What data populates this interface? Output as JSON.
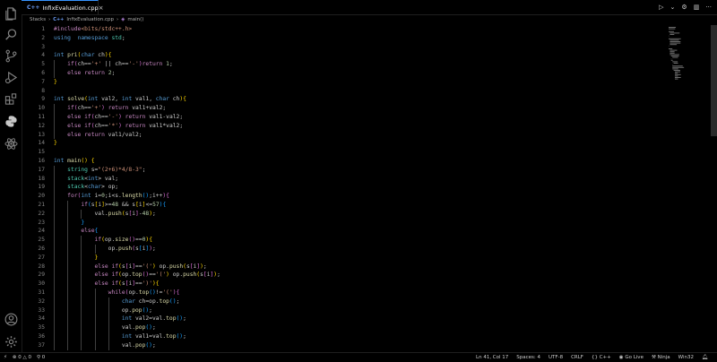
{
  "tab": {
    "icon_text": "C++",
    "filename": "InfixEvaluation.cpp",
    "close": "×"
  },
  "tab_actions": {
    "run": "▷",
    "run_dropdown": "⌄",
    "settings": "⚙",
    "split": "▥",
    "more": "···"
  },
  "breadcrumb": {
    "folder": "Stacks",
    "sep1": "›",
    "file": "InfixEvaluation.cpp",
    "sep2": "›",
    "func_icon": "◈",
    "func": "main()"
  },
  "status": {
    "remote": "⚡",
    "errors": "0",
    "warnings": "0",
    "ports": "0",
    "position": "Ln 41, Col 17",
    "spaces": "Spaces: 4",
    "encoding": "UTF-8",
    "eol": "CRLF",
    "language": "C++",
    "golive": "Go Live",
    "ninja": "Ninja",
    "platform": "Win32"
  },
  "colors": {
    "accent": "#3794ff",
    "background": "#000000",
    "keyword": "#569cd6",
    "string": "#ce9178",
    "function": "#dcdcaa",
    "type": "#4ec9b0",
    "preprocessor": "#c586c0"
  },
  "code_lines": [
    {
      "n": "1",
      "t": [
        [
          "pp",
          "#include"
        ],
        [
          "inc",
          "<bits/stdc++.h>"
        ]
      ]
    },
    {
      "n": "2",
      "t": [
        [
          "kw",
          "using"
        ],
        [
          "",
          "  "
        ],
        [
          "kw",
          "namespace"
        ],
        [
          "",
          ""
        ],
        [
          "ty",
          " std"
        ],
        [
          "",
          ";"
        ]
      ]
    },
    {
      "n": "3",
      "t": []
    },
    {
      "n": "4",
      "t": [
        [
          "kw",
          "int"
        ],
        [
          "",
          " "
        ],
        [
          "fn",
          "pri"
        ],
        [
          "br1",
          "("
        ],
        [
          "kw",
          "char"
        ],
        [
          "",
          " ch"
        ],
        [
          "br1",
          ")"
        ],
        [
          "br1",
          "{"
        ]
      ]
    },
    {
      "n": "5",
      "t": [
        [
          "",
          "    "
        ],
        [
          "ctl",
          "if"
        ],
        [
          "br2",
          "("
        ],
        [
          "",
          "ch=="
        ],
        [
          "str",
          "'+'"
        ],
        [
          "",
          " || ch=="
        ],
        [
          "str",
          "'-'"
        ],
        [
          "br2",
          ")"
        ],
        [
          "ctl",
          "return"
        ],
        [
          "",
          " "
        ],
        [
          "num",
          "1"
        ],
        [
          "",
          ";"
        ]
      ]
    },
    {
      "n": "6",
      "t": [
        [
          "",
          "    "
        ],
        [
          "ctl",
          "else"
        ],
        [
          "",
          " "
        ],
        [
          "ctl",
          "return"
        ],
        [
          "",
          " "
        ],
        [
          "num",
          "2"
        ],
        [
          "",
          ";"
        ]
      ]
    },
    {
      "n": "7",
      "t": [
        [
          "br1",
          "}"
        ]
      ]
    },
    {
      "n": "8",
      "t": []
    },
    {
      "n": "9",
      "t": [
        [
          "kw",
          "int"
        ],
        [
          "",
          " "
        ],
        [
          "fn",
          "solve"
        ],
        [
          "br1",
          "("
        ],
        [
          "kw",
          "int"
        ],
        [
          "",
          " val2, "
        ],
        [
          "kw",
          "int"
        ],
        [
          "",
          " val1, "
        ],
        [
          "kw",
          "char"
        ],
        [
          "",
          " ch"
        ],
        [
          "br1",
          ")"
        ],
        [
          "br1",
          "{"
        ]
      ]
    },
    {
      "n": "10",
      "t": [
        [
          "",
          "    "
        ],
        [
          "ctl",
          "if"
        ],
        [
          "br2",
          "("
        ],
        [
          "",
          "ch=="
        ],
        [
          "str",
          "'+'"
        ],
        [
          "br2",
          ")"
        ],
        [
          "",
          " "
        ],
        [
          "ctl",
          "return"
        ],
        [
          "",
          " val1+val2;"
        ]
      ]
    },
    {
      "n": "11",
      "t": [
        [
          "",
          "    "
        ],
        [
          "ctl",
          "else if"
        ],
        [
          "br2",
          "("
        ],
        [
          "",
          "ch=="
        ],
        [
          "str",
          "'-'"
        ],
        [
          "br2",
          ")"
        ],
        [
          "",
          " "
        ],
        [
          "ctl",
          "return"
        ],
        [
          "",
          " val1-val2;"
        ]
      ]
    },
    {
      "n": "12",
      "t": [
        [
          "",
          "    "
        ],
        [
          "ctl",
          "else if"
        ],
        [
          "br2",
          "("
        ],
        [
          "",
          "ch=="
        ],
        [
          "str",
          "'*'"
        ],
        [
          "br2",
          ")"
        ],
        [
          "",
          " "
        ],
        [
          "ctl",
          "return"
        ],
        [
          "",
          " val1*val2;"
        ]
      ]
    },
    {
      "n": "13",
      "t": [
        [
          "",
          "    "
        ],
        [
          "ctl",
          "else"
        ],
        [
          "",
          " "
        ],
        [
          "ctl",
          "return"
        ],
        [
          "",
          " val1/val2;"
        ]
      ]
    },
    {
      "n": "14",
      "t": [
        [
          "br1",
          "}"
        ]
      ]
    },
    {
      "n": "15",
      "t": []
    },
    {
      "n": "16",
      "t": [
        [
          "kw",
          "int"
        ],
        [
          "",
          " "
        ],
        [
          "fn",
          "main"
        ],
        [
          "br1",
          "()"
        ],
        [
          "",
          " "
        ],
        [
          "br1",
          "{"
        ]
      ]
    },
    {
      "n": "17",
      "t": [
        [
          "",
          "    "
        ],
        [
          "ty",
          "string"
        ],
        [
          "",
          " s="
        ],
        [
          "str",
          "\"(2+6)*4/8-3\""
        ],
        [
          "",
          ";"
        ]
      ]
    },
    {
      "n": "18",
      "t": [
        [
          "",
          "    "
        ],
        [
          "ty",
          "stack"
        ],
        [
          "",
          "<"
        ],
        [
          "kw",
          "int"
        ],
        [
          "",
          "> val;"
        ]
      ]
    },
    {
      "n": "19",
      "t": [
        [
          "",
          "    "
        ],
        [
          "ty",
          "stack"
        ],
        [
          "",
          "<"
        ],
        [
          "kw",
          "char"
        ],
        [
          "",
          "> op;"
        ]
      ]
    },
    {
      "n": "20",
      "t": [
        [
          "",
          "    "
        ],
        [
          "ctl",
          "for"
        ],
        [
          "br2",
          "("
        ],
        [
          "kw",
          "int"
        ],
        [
          "",
          " i="
        ],
        [
          "num",
          "0"
        ],
        [
          "",
          ";i<s."
        ],
        [
          "fn",
          "length"
        ],
        [
          "br3",
          "()"
        ],
        [
          "",
          ";i++"
        ],
        [
          "br2",
          ")"
        ],
        [
          "br2",
          "{"
        ]
      ]
    },
    {
      "n": "21",
      "t": [
        [
          "",
          "        "
        ],
        [
          "ctl",
          "if"
        ],
        [
          "br3",
          "("
        ],
        [
          "",
          "s"
        ],
        [
          "br1",
          "["
        ],
        [
          "",
          "i"
        ],
        [
          "br1",
          "]"
        ],
        [
          "",
          ">="
        ],
        [
          "num",
          "48"
        ],
        [
          "",
          " && s"
        ],
        [
          "br1",
          "["
        ],
        [
          "",
          "i"
        ],
        [
          "br1",
          "]"
        ],
        [
          "",
          "<="
        ],
        [
          "num",
          "57"
        ],
        [
          "br3",
          ")"
        ],
        [
          "br3",
          "{"
        ]
      ]
    },
    {
      "n": "22",
      "t": [
        [
          "",
          "            val."
        ],
        [
          "fn",
          "push"
        ],
        [
          "br1",
          "("
        ],
        [
          "",
          "s"
        ],
        [
          "br2",
          "["
        ],
        [
          "",
          "i"
        ],
        [
          "br2",
          "]"
        ],
        [
          "",
          "-"
        ],
        [
          "num",
          "48"
        ],
        [
          "br1",
          ")"
        ],
        [
          "",
          ";"
        ]
      ]
    },
    {
      "n": "23",
      "t": [
        [
          "",
          "        "
        ],
        [
          "br3",
          "}"
        ]
      ]
    },
    {
      "n": "24",
      "t": [
        [
          "",
          "        "
        ],
        [
          "ctl",
          "else"
        ],
        [
          "br3",
          "{"
        ]
      ]
    },
    {
      "n": "25",
      "t": [
        [
          "",
          "            "
        ],
        [
          "ctl",
          "if"
        ],
        [
          "br1",
          "("
        ],
        [
          "",
          "op."
        ],
        [
          "fn",
          "size"
        ],
        [
          "br2",
          "()"
        ],
        [
          "",
          "=="
        ],
        [
          "num",
          "0"
        ],
        [
          "br1",
          ")"
        ],
        [
          "br1",
          "{"
        ]
      ]
    },
    {
      "n": "26",
      "t": [
        [
          "",
          "                op."
        ],
        [
          "fn",
          "push"
        ],
        [
          "br2",
          "("
        ],
        [
          "",
          "s"
        ],
        [
          "br3",
          "["
        ],
        [
          "",
          "i"
        ],
        [
          "br3",
          "]"
        ],
        [
          "br2",
          ")"
        ],
        [
          "",
          ";"
        ]
      ]
    },
    {
      "n": "27",
      "t": [
        [
          "",
          "            "
        ],
        [
          "br1",
          "}"
        ]
      ]
    },
    {
      "n": "28",
      "t": [
        [
          "",
          "            "
        ],
        [
          "ctl",
          "else if"
        ],
        [
          "br1",
          "("
        ],
        [
          "",
          "s"
        ],
        [
          "br2",
          "["
        ],
        [
          "",
          "i"
        ],
        [
          "br2",
          "]"
        ],
        [
          "",
          "=="
        ],
        [
          "str",
          "'('"
        ],
        [
          "br1",
          ")"
        ],
        [
          "",
          " op."
        ],
        [
          "fn",
          "push"
        ],
        [
          "br1",
          "("
        ],
        [
          "",
          "s"
        ],
        [
          "br2",
          "["
        ],
        [
          "",
          "i"
        ],
        [
          "br2",
          "]"
        ],
        [
          "br1",
          ")"
        ],
        [
          "",
          ";"
        ]
      ]
    },
    {
      "n": "29",
      "t": [
        [
          "",
          "            "
        ],
        [
          "ctl",
          "else if"
        ],
        [
          "br1",
          "("
        ],
        [
          "",
          "op."
        ],
        [
          "fn",
          "top"
        ],
        [
          "br2",
          "()"
        ],
        [
          "",
          "=="
        ],
        [
          "str",
          "'('"
        ],
        [
          "br1",
          ")"
        ],
        [
          "",
          " op."
        ],
        [
          "fn",
          "push"
        ],
        [
          "br1",
          "("
        ],
        [
          "",
          "s"
        ],
        [
          "br2",
          "["
        ],
        [
          "",
          "i"
        ],
        [
          "br2",
          "]"
        ],
        [
          "br1",
          ")"
        ],
        [
          "",
          ";"
        ]
      ]
    },
    {
      "n": "30",
      "t": [
        [
          "",
          "            "
        ],
        [
          "ctl",
          "else if"
        ],
        [
          "br1",
          "("
        ],
        [
          "",
          "s"
        ],
        [
          "br2",
          "["
        ],
        [
          "",
          "i"
        ],
        [
          "br2",
          "]"
        ],
        [
          "",
          "=="
        ],
        [
          "str",
          "')'"
        ],
        [
          "br1",
          ")"
        ],
        [
          "br1",
          "{"
        ]
      ]
    },
    {
      "n": "31",
      "t": [
        [
          "",
          "                "
        ],
        [
          "ctl",
          "while"
        ],
        [
          "br2",
          "("
        ],
        [
          "",
          "op."
        ],
        [
          "fn",
          "top"
        ],
        [
          "br3",
          "()"
        ],
        [
          "",
          "!="
        ],
        [
          "str",
          "'('"
        ],
        [
          "br2",
          ")"
        ],
        [
          "br2",
          "{"
        ]
      ]
    },
    {
      "n": "32",
      "t": [
        [
          "",
          "                    "
        ],
        [
          "kw",
          "char"
        ],
        [
          "",
          " ch=op."
        ],
        [
          "fn",
          "top"
        ],
        [
          "br3",
          "()"
        ],
        [
          "",
          ";"
        ]
      ]
    },
    {
      "n": "33",
      "t": [
        [
          "",
          "                    op."
        ],
        [
          "fn",
          "pop"
        ],
        [
          "br3",
          "()"
        ],
        [
          "",
          ";"
        ]
      ]
    },
    {
      "n": "34",
      "t": [
        [
          "",
          "                    "
        ],
        [
          "kw",
          "int"
        ],
        [
          "",
          " val2=val."
        ],
        [
          "fn",
          "top"
        ],
        [
          "br3",
          "()"
        ],
        [
          "",
          ";"
        ]
      ]
    },
    {
      "n": "35",
      "t": [
        [
          "",
          "                    val."
        ],
        [
          "fn",
          "pop"
        ],
        [
          "br3",
          "()"
        ],
        [
          "",
          ";"
        ]
      ]
    },
    {
      "n": "36",
      "t": [
        [
          "",
          "                    "
        ],
        [
          "kw",
          "int"
        ],
        [
          "",
          " val1=val."
        ],
        [
          "fn",
          "top"
        ],
        [
          "br3",
          "()"
        ],
        [
          "",
          ";"
        ]
      ]
    },
    {
      "n": "37",
      "t": [
        [
          "",
          "                    val."
        ],
        [
          "fn",
          "pop"
        ],
        [
          "br3",
          "()"
        ],
        [
          "",
          ";"
        ]
      ]
    }
  ]
}
